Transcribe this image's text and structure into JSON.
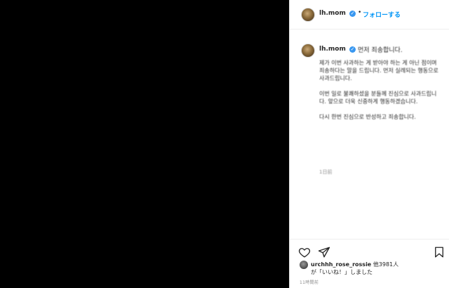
{
  "post": {
    "username": "lh.mom",
    "follow_label": "フォローする",
    "separator": "•"
  },
  "caption": {
    "username": "lh.mom",
    "first_line": "먼저 죄송합니다.",
    "paragraphs": [
      "제가 이번 사과하는 게 받아야 하는 게 아닌 점이며 죄송하다는 말을 드립니다. 먼저 실례되는 행동으로 사과드립니다.",
      "이번 일로 불쾌하셨을 분들께 진심으로 사과드립니다. 앞으로 더욱 신중하게 행동하겠습니다.",
      "다시 한번 진심으로 반성하고 죄송합니다."
    ],
    "time": "1日前"
  },
  "likes": {
    "liker": "urchhh_rose_rossie",
    "suffix": "他3981人",
    "line2": "が「いいね！」しました"
  },
  "date": "11時間前",
  "icons": {
    "heart": "heart-icon",
    "share": "share-icon",
    "bookmark": "bookmark-icon",
    "verified": "verified-icon"
  },
  "colors": {
    "link": "#0095f6",
    "verified": "#3897f0",
    "text": "#262626",
    "muted": "#8e8e8e"
  }
}
